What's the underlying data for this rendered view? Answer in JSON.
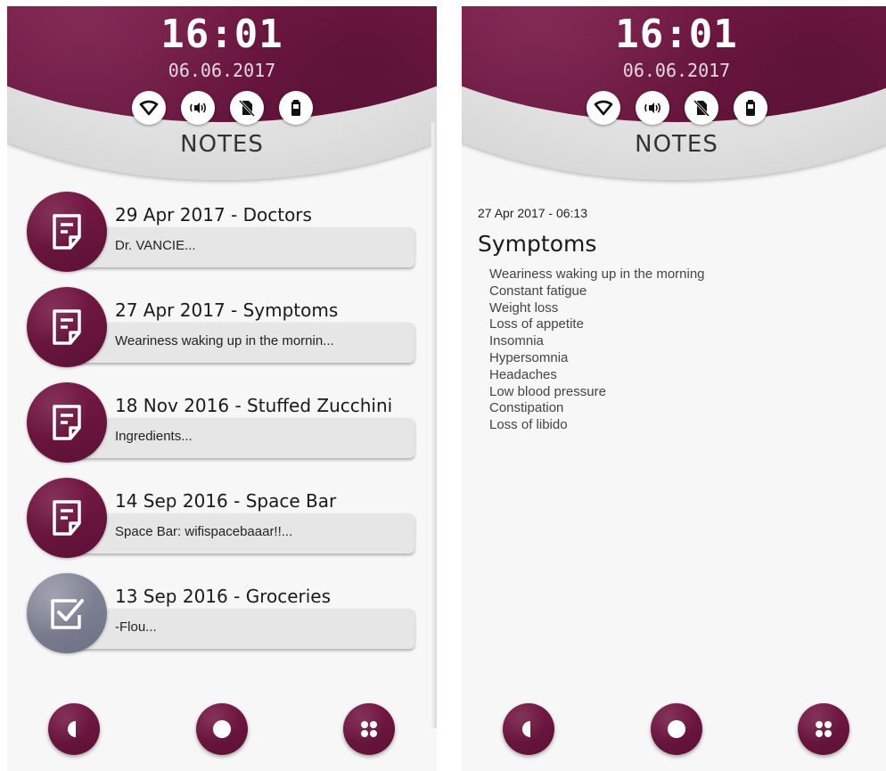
{
  "colors": {
    "accent": "#6b1540",
    "accent_gray": "#7b7e91",
    "bubble": "#e6e6e6",
    "background": "#f7f7f7"
  },
  "header": {
    "time": "16:01",
    "date": "06.06.2017",
    "status_icons": [
      "wifi-icon",
      "sound-icon",
      "no-sim-icon",
      "battery-icon"
    ],
    "title": "NOTES"
  },
  "notes_list": {
    "items": [
      {
        "title": "29 Apr 2017 - Doctors",
        "preview": "Dr. VANCIE...",
        "icon": "note-icon"
      },
      {
        "title": "27 Apr 2017 - Symptoms",
        "preview": "Weariness waking up in the mornin...",
        "icon": "note-icon"
      },
      {
        "title": "18 Nov 2016 - Stuffed Zucchini",
        "preview": "Ingredients...",
        "icon": "note-icon"
      },
      {
        "title": "14 Sep 2016 - Space Bar",
        "preview": "Space Bar: wifispacebaaar!!...",
        "icon": "note-icon"
      },
      {
        "title": "13 Sep 2016 - Groceries",
        "preview": "-Flou...",
        "icon": "checklist-icon"
      }
    ]
  },
  "note_detail": {
    "timestamp": "27 Apr 2017 - 06:13",
    "title": "Symptoms",
    "lines": [
      "Weariness waking up in the morning",
      "Constant fatigue",
      "Weight loss",
      "Loss of appetite",
      "Insomnia",
      "Hypersomnia",
      "Headaches",
      "Low blood pressure",
      "Constipation",
      "Loss of libido"
    ]
  },
  "bottom_bar": {
    "buttons": [
      "back-icon",
      "home-icon",
      "apps-icon"
    ]
  }
}
